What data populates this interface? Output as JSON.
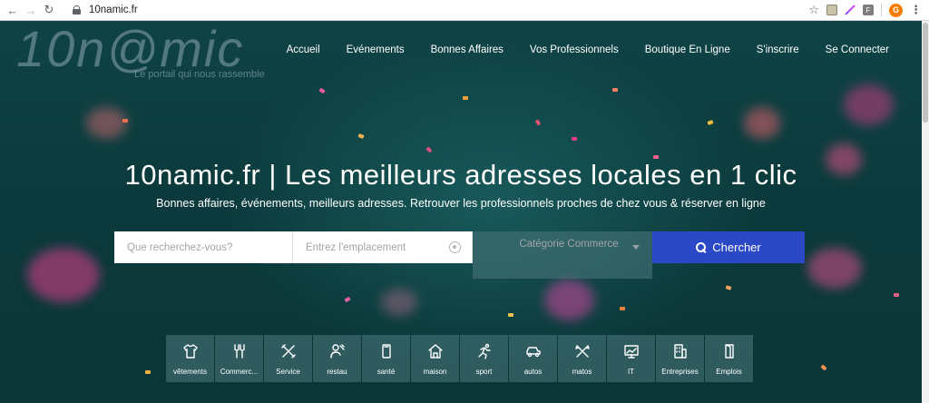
{
  "browser": {
    "url": "10namic.fr",
    "avatar_letter": "G",
    "ext3_letter": "F"
  },
  "site": {
    "logo_text": "10n@mic",
    "tagline": "Le portail qui nous rassemble"
  },
  "nav": {
    "items": [
      {
        "label": "Accueil"
      },
      {
        "label": "Evénements"
      },
      {
        "label": "Bonnes Affaires"
      },
      {
        "label": "Vos Professionnels"
      },
      {
        "label": "Boutique En Ligne"
      },
      {
        "label": "S'inscrire"
      },
      {
        "label": "Se Connecter"
      }
    ]
  },
  "hero": {
    "headline": "10namic.fr | Les meilleurs adresses locales en 1 clic",
    "subline": "Bonnes affaires, événements, meilleurs adresses. Retrouver les professionnels proches de chez vous & réserver en ligne"
  },
  "search": {
    "query_placeholder": "Que recherchez-vous?",
    "location_placeholder": "Entrez l'emplacement",
    "category_placeholder": "Catégorie Commerce",
    "button_label": "Chercher"
  },
  "categories": [
    {
      "label": "vêtements",
      "icon": "tshirt-icon"
    },
    {
      "label": "Commerc...",
      "icon": "shop-icon"
    },
    {
      "label": "Service",
      "icon": "tools-icon"
    },
    {
      "label": "restau",
      "icon": "chef-icon"
    },
    {
      "label": "santé",
      "icon": "phone-icon"
    },
    {
      "label": "maison",
      "icon": "house-icon"
    },
    {
      "label": "sport",
      "icon": "runner-icon"
    },
    {
      "label": "autos",
      "icon": "car-icon"
    },
    {
      "label": "matos",
      "icon": "wrench-icon"
    },
    {
      "label": "IT",
      "icon": "monitor-icon"
    },
    {
      "label": "Entreprises",
      "icon": "building-icon"
    },
    {
      "label": "Emplois",
      "icon": "door-icon"
    }
  ],
  "colors": {
    "accent": "#2b48c7",
    "hero_bg": "#0e3a3c",
    "category_tile": "#46737a"
  }
}
